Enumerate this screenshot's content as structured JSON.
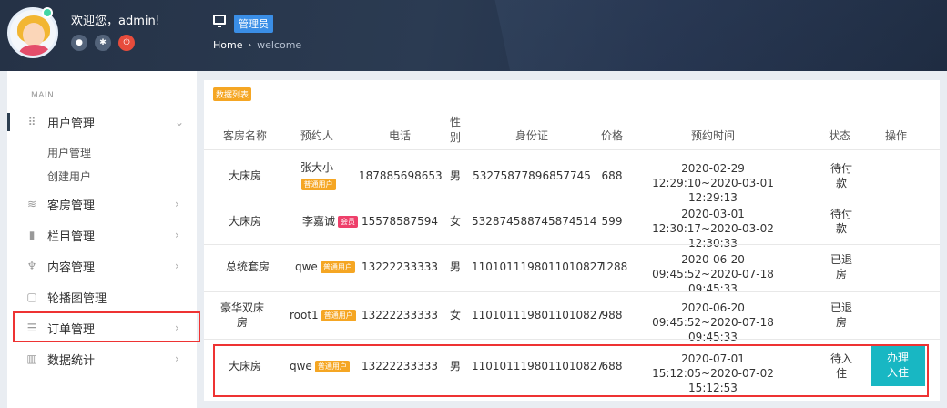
{
  "header": {
    "welcome": "欢迎您，admin!",
    "role": "管理员",
    "breadcrumb": {
      "home": "Home",
      "separator": "›",
      "current": "welcome"
    },
    "icons": [
      "user-icon",
      "gear-icon",
      "power-icon"
    ]
  },
  "sidebar": {
    "section": "MAIN",
    "items": [
      {
        "label": "用户管理",
        "icon": "grid-icon",
        "expanded": true
      },
      {
        "label": "客房管理",
        "icon": "layers-icon"
      },
      {
        "label": "栏目管理",
        "icon": "file-icon"
      },
      {
        "label": "内容管理",
        "icon": "rocket-icon"
      },
      {
        "label": "轮播图管理",
        "icon": "clipboard-icon"
      },
      {
        "label": "订单管理",
        "icon": "list-icon"
      },
      {
        "label": "数据统计",
        "icon": "bar-chart-icon"
      }
    ],
    "subitems": [
      "用户管理",
      "创建用户"
    ]
  },
  "table": {
    "tag": "数据列表",
    "columns": [
      "客房名称",
      "预约人",
      "电话",
      "性别",
      "身份证",
      "价格",
      "预约时间",
      "状态",
      "操作"
    ],
    "rows": [
      {
        "room": "大床房",
        "booker": "张大小",
        "badge": "普通用户",
        "phone": "187885698653",
        "sex": "男",
        "id": "53275877896857745",
        "price": "688",
        "time": "2020-02-29 12:29:10~2020-03-01 12:29:13",
        "status": "待付款",
        "action": ""
      },
      {
        "room": "大床房",
        "booker": "李嘉诚",
        "badge": "会员",
        "phone": "15578587594",
        "sex": "女",
        "id": "532874588745874514",
        "price": "599",
        "time": "2020-03-01 12:30:17~2020-03-02 12:30:33",
        "status": "待付款",
        "action": ""
      },
      {
        "room": "总统套房",
        "booker": "qwe",
        "badge": "普通用户",
        "phone": "13222233333",
        "sex": "男",
        "id": "1101011198011010827",
        "price": "1288",
        "time": "2020-06-20 09:45:52~2020-07-18 09:45:33",
        "status": "已退房",
        "action": ""
      },
      {
        "room": "豪华双床房",
        "booker": "root1",
        "badge": "普通用户",
        "phone": "13222233333",
        "sex": "女",
        "id": "1101011198011010827",
        "price": "988",
        "time": "2020-06-20 09:45:52~2020-07-18 09:45:33",
        "status": "已退房",
        "action": ""
      },
      {
        "room": "大床房",
        "booker": "qwe",
        "badge": "普通用户",
        "phone": "13222233333",
        "sex": "男",
        "id": "1101011198011010827",
        "price": "688",
        "time": "2020-07-01 15:12:05~2020-07-02 15:12:53",
        "status": "待入住",
        "action": "办理入住"
      }
    ]
  },
  "colors": {
    "accent": "#18b7c3",
    "highlight": "#e33333",
    "badge_member": "#ee3f6a",
    "badge_normal": "#f5a623",
    "role": "#3a8ee6"
  }
}
